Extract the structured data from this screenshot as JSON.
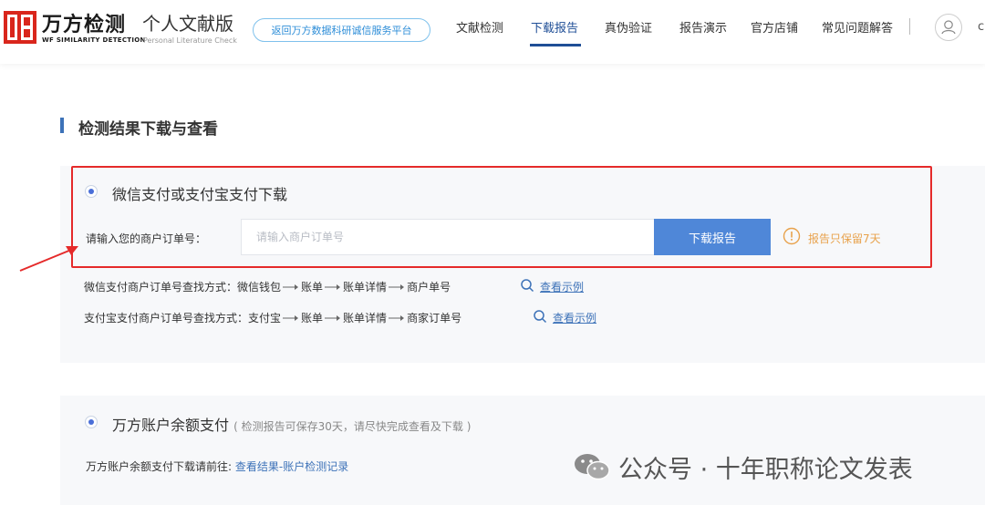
{
  "header": {
    "logo_cn": "万方检测",
    "logo_en": "WF SIMILARITY DETECTION",
    "edition_cn": "个人文献版",
    "edition_en": "Personal Literature Check",
    "platform_button": "返回万方数据科研诚信服务平台",
    "nav": [
      {
        "label": "文献检测",
        "active": false
      },
      {
        "label": "下载报告",
        "active": true
      },
      {
        "label": "真伪验证",
        "active": false
      },
      {
        "label": "报告演示",
        "active": false
      },
      {
        "label": "官方店铺",
        "active": false
      },
      {
        "label": "常见问题解答",
        "active": false
      }
    ],
    "avatar_icon": "user-icon",
    "avatar_tail": "c"
  },
  "section": {
    "title": "检测结果下载与查看"
  },
  "wechat_alipay": {
    "option_title": "微信支付或支付宝支付下载",
    "field_label": "请输入您的商户订单号：",
    "input_placeholder": "请输入商户订单号",
    "input_value": "",
    "download_button": "下载报告",
    "warning_text": "报告只保留7天",
    "wechat_guide": {
      "prefix": "微信支付商户订单号查找方式：",
      "steps": [
        "微信钱包",
        "账单",
        "账单详情",
        "商户单号"
      ],
      "link": "查看示例"
    },
    "alipay_guide": {
      "prefix": "支付宝支付商户订单号查找方式：",
      "steps": [
        "支付宝",
        "账单",
        "账单详情",
        "商家订单号"
      ],
      "link": "查看示例"
    }
  },
  "balance": {
    "option_title": "万方账户余额支付",
    "option_note": "( 检测报告可保存30天，请尽快完成查看及下载 )",
    "label": "万方账户余额支付下载请前往:",
    "link": "查看结果-账户检测记录"
  },
  "watermark": {
    "text": "公众号 · 十年职称论文发表",
    "icon": "wechat-icon"
  },
  "colors": {
    "accent": "#1f4e96",
    "button": "#4f87d8",
    "highlight": "#e52a2a",
    "warning": "#e8a24c",
    "link": "#3d72b8"
  }
}
